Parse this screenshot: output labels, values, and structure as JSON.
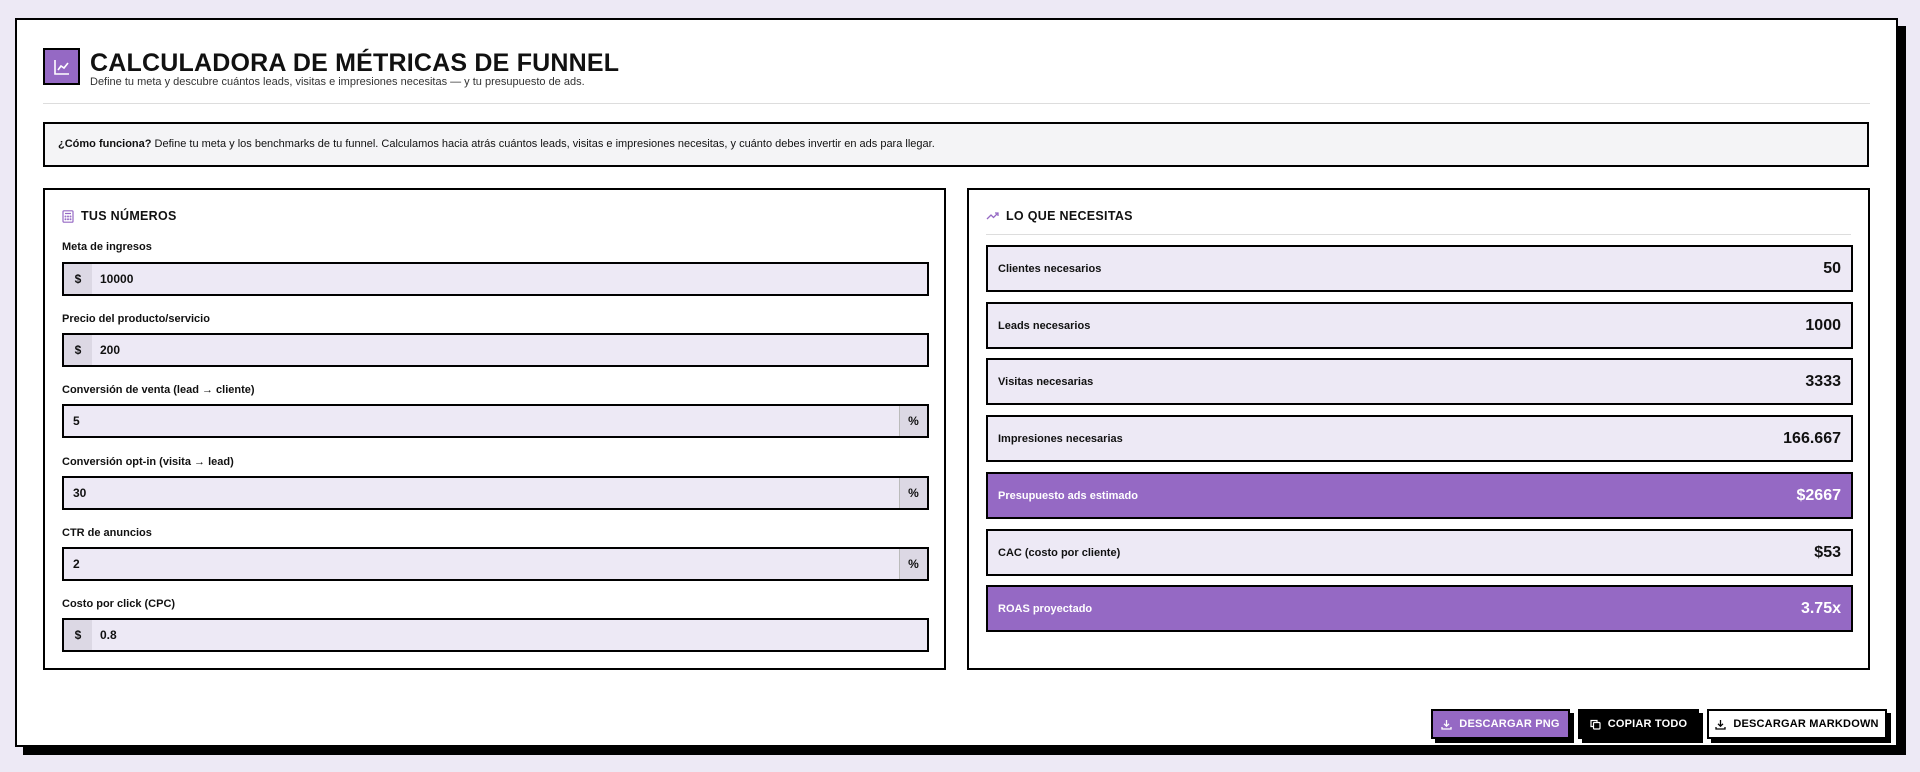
{
  "header": {
    "title": "CALCULADORA DE MÉTRICAS DE FUNNEL",
    "subtitle": "Define tu meta y descubre cuántos leads, visitas e impresiones necesitas — y tu presupuesto de ads.",
    "logo_icon": "chart-line-icon"
  },
  "info": {
    "bold": "¿Cómo funciona?",
    "text": " Define tu meta y los benchmarks de tu funnel. Calculamos hacia atrás cuántos leads, visitas e impresiones necesitas, y cuánto debes invertir en ads para llegar."
  },
  "inputs_panel": {
    "title": "TUS NÚMEROS",
    "icon": "calculator-icon",
    "fields": [
      {
        "label": "Meta de ingresos",
        "prefix": "$",
        "suffix": "",
        "value": "10000"
      },
      {
        "label": "Precio del producto/servicio",
        "prefix": "$",
        "suffix": "",
        "value": "200"
      },
      {
        "label": "Conversión de venta (lead → cliente)",
        "prefix": "",
        "suffix": "%",
        "value": "5"
      },
      {
        "label": "Conversión opt-in (visita → lead)",
        "prefix": "",
        "suffix": "%",
        "value": "30"
      },
      {
        "label": "CTR de anuncios",
        "prefix": "",
        "suffix": "%",
        "value": "2"
      },
      {
        "label": "Costo por click (CPC)",
        "prefix": "$",
        "suffix": "",
        "value": "0.8"
      }
    ]
  },
  "results_panel": {
    "title": "LO QUE NECESITAS",
    "icon": "trending-up-icon",
    "metrics": [
      {
        "label": "Clientes necesarios",
        "value": "50"
      },
      {
        "label": "Leads necesarios",
        "value": "1000"
      },
      {
        "label": "Visitas necesarias",
        "value": "3333"
      },
      {
        "label": "Impresiones necesarias",
        "value": "166.667"
      },
      {
        "label": "Presupuesto ads estimado",
        "value": "$2667"
      },
      {
        "label": "CAC (costo por cliente)",
        "value": "$53"
      },
      {
        "label": "ROAS proyectado",
        "value": "3.75x"
      }
    ]
  },
  "actions": {
    "png": "DESCARGAR PNG",
    "copy": "COPIAR TODO",
    "markdown": "DESCARGAR MARKDOWN"
  },
  "colors": {
    "accent": "#9569c4",
    "background": "#ede9f5",
    "field_bg": "#ede9f5"
  }
}
